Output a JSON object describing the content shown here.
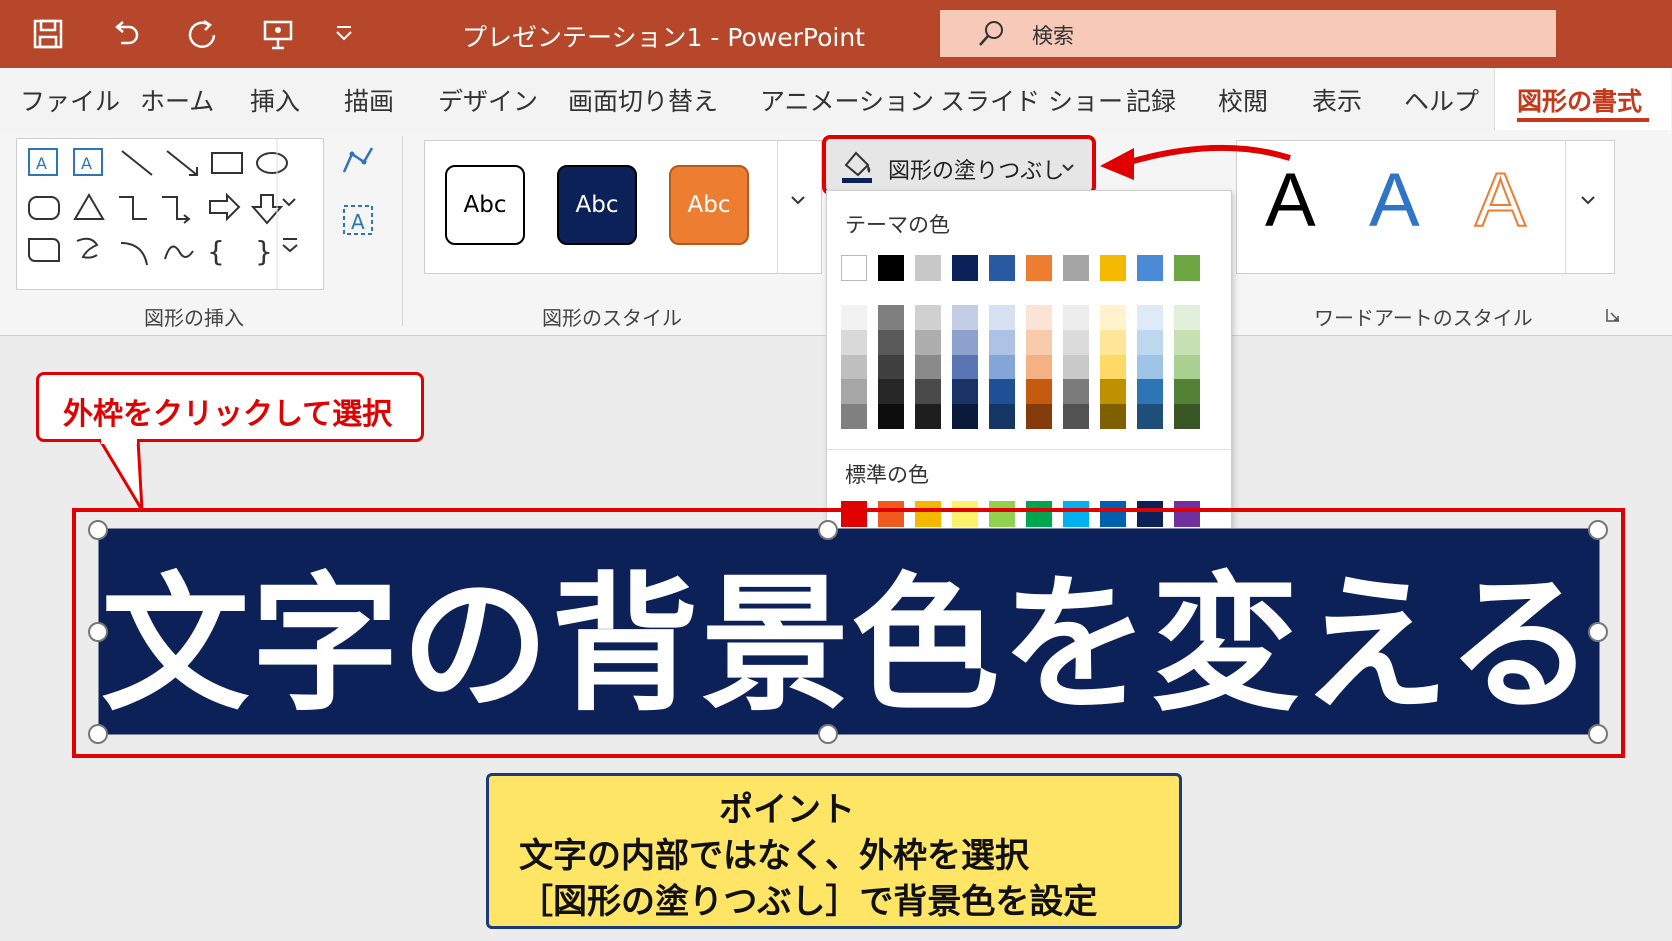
{
  "app_title": "プレゼンテーション1  -  PowerPoint",
  "search": {
    "label": "検索",
    "icon": "search-icon"
  },
  "quick_access": [
    "save-icon",
    "undo-icon",
    "redo-icon",
    "present-icon",
    "customize-dropdown-icon"
  ],
  "tabs": [
    "ファイル",
    "ホーム",
    "挿入",
    "描画",
    "デザイン",
    "画面切り替え",
    "アニメーション",
    "スライド ショー",
    "記録",
    "校閲",
    "表示",
    "ヘルプ"
  ],
  "active_tab": "図形の書式",
  "ribbon": {
    "insert_shapes_label": "図形の挿入",
    "shape_styles_label": "図形のスタイル",
    "wordart_styles_label": "ワードアートのスタイル",
    "style_presets": [
      {
        "label": "Abc",
        "bg": "#ffffff",
        "fg": "#000000",
        "border": "#000000"
      },
      {
        "label": "Abc",
        "bg": "#0d2159",
        "fg": "#ffffff",
        "border": "#000000"
      },
      {
        "label": "Abc",
        "bg": "#ed7d31",
        "fg": "#ffffff",
        "border": "#b55a1c"
      }
    ],
    "wordart": [
      {
        "label": "A",
        "color": "#000000",
        "style": "solid"
      },
      {
        "label": "A",
        "color": "#2e75c8",
        "style": "solid"
      },
      {
        "label": "A",
        "color": "#ed7d31",
        "style": "outline"
      }
    ],
    "fill_button_label": "図形の塗りつぶし"
  },
  "dropdown": {
    "theme_colors_label": "テーマの色",
    "theme_colors": [
      "#ffffff",
      "#000000",
      "#c8c8c8",
      "#0d2159",
      "#2a59a4",
      "#ed7d31",
      "#a5a5a5",
      "#f4b800",
      "#4a8ad6",
      "#6ca744"
    ],
    "shade_columns": [
      [
        "#f2f2f2",
        "#d9d9d9",
        "#bfbfbf",
        "#a6a6a6",
        "#808080"
      ],
      [
        "#7f7f7f",
        "#595959",
        "#404040",
        "#262626",
        "#0d0d0d"
      ],
      [
        "#d0d0d0",
        "#aeaeae",
        "#8a8a8a",
        "#4a4a4a",
        "#1e1e1e"
      ],
      [
        "#c3cde6",
        "#8ea1cd",
        "#5a75b3",
        "#1a3366",
        "#0b1a3a"
      ],
      [
        "#d6e1f2",
        "#adc3e5",
        "#84a5d8",
        "#1f4f94",
        "#153564"
      ],
      [
        "#fbe4d5",
        "#f8cbad",
        "#f4b183",
        "#c55a11",
        "#843c0c"
      ],
      [
        "#ededed",
        "#dbdbdb",
        "#c9c9c9",
        "#7b7b7b",
        "#525252"
      ],
      [
        "#fff2cc",
        "#ffe699",
        "#ffd966",
        "#bf9000",
        "#7f6000"
      ],
      [
        "#deebf7",
        "#bdd7ee",
        "#9dc3e6",
        "#2e75b6",
        "#1f4e79"
      ],
      [
        "#e2efda",
        "#c6e0b4",
        "#a9d08e",
        "#538135",
        "#375623"
      ]
    ],
    "standard_colors_label": "標準の色",
    "standard_colors": [
      "#e00000",
      "#f05a1e",
      "#f4b800",
      "#fff06e",
      "#92d050",
      "#00a550",
      "#00b0f0",
      "#0060b0",
      "#0d2159",
      "#7030a0"
    ]
  },
  "slide": {
    "callout_text": "外枠をクリックして選択",
    "shape_text": "文字の背景色を変える",
    "shape_fill": "#0d2159",
    "point_box": {
      "title": "ポイント",
      "line1": "文字の内部ではなく、外枠を選択",
      "line2": "［図形の塗りつぶし］で背景色を設定"
    }
  },
  "colors": {
    "accent": "#b7472a",
    "highlight": "#e00000"
  }
}
